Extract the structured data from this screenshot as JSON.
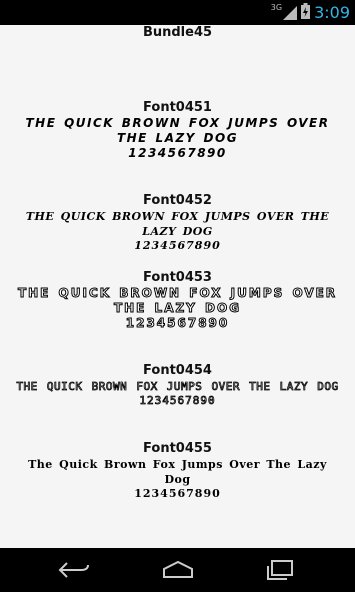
{
  "statusbar": {
    "network": "3G",
    "time": "3:09"
  },
  "bundle_title": "Bundle45",
  "fonts": [
    {
      "name": "Font0451",
      "sample": "The Quick Brown Fox Jumps Over The Lazy Dog",
      "digits": "1234567890"
    },
    {
      "name": "Font0452",
      "sample": "The Quick Brown Fox Jumps Over The Lazy Dog",
      "digits": "1234567890"
    },
    {
      "name": "Font0453",
      "sample": "The Quick Brown Fox Jumps Over The Lazy Dog",
      "digits": "1234567890"
    },
    {
      "name": "Font0454",
      "sample": "The Quick Brown Fox Jumps Over The Lazy Dog",
      "digits": "1234567890"
    },
    {
      "name": "Font0455",
      "sample": "The Quick Brown Fox Jumps Over The Lazy Dog",
      "digits": "1234567890"
    }
  ],
  "colors": {
    "accent": "#33b5e5",
    "background": "#f5f5f5",
    "bars": "#000000"
  },
  "icons": [
    "signal-icon",
    "battery-icon",
    "back-icon",
    "home-icon",
    "recents-icon"
  ]
}
